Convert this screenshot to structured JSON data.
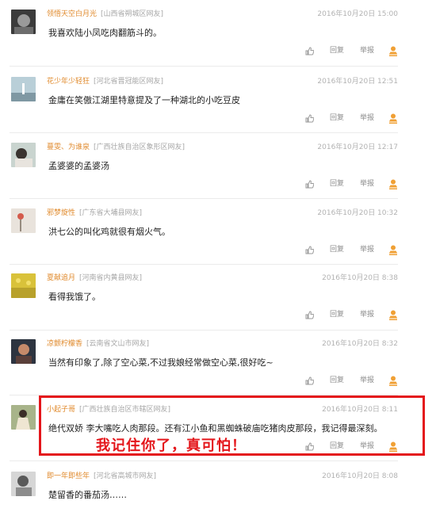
{
  "actions": {
    "reply": "回复",
    "report": "举报"
  },
  "comments": [
    {
      "user": "领悟天空白月光",
      "location": "[山西省朔城区网友]",
      "time": "2016年10月20日 15:00",
      "text": "我喜欢陆小凤吃肉翻筋斗的。"
    },
    {
      "user": "花少年少轻狂",
      "location": "[河北省晋冠能区网友]",
      "time": "2016年10月20日 12:51",
      "text": "金庸在笑傲江湖里特意提及了一种湖北的小吃豆皮"
    },
    {
      "user": "蔓雯、为谁泉",
      "location": "[广西壮族自治区象形区网友]",
      "time": "2016年10月20日 12:17",
      "text": "孟婆婆的孟婆汤"
    },
    {
      "user": "邪梦旋性",
      "location": "[广东省大埔县网友]",
      "time": "2016年10月20日 10:32",
      "text": "洪七公的叫化鸡就很有烟火气。"
    },
    {
      "user": "夏献追月",
      "location": "[河南省内黄县网友]",
      "time": "2016年10月20日 8:38",
      "text": "看得我饿了。"
    },
    {
      "user": "凉颤柠檬香",
      "location": "[云南省文山市网友]",
      "time": "2016年10月20日 8:32",
      "text": "当然有印象了,除了空心菜,不过我娘经常做空心菜,很好吃~"
    },
    {
      "user": "小起子哥",
      "location": "[广西壮族自治区市辖区网友]",
      "time": "2016年10月20日 8:11",
      "text": "绝代双娇 李大嘴吃人肉那段。还有江小鱼和黑蜘蛛破庙吃猪肉皮那段，我记得最深刻。"
    },
    {
      "user": "即一年即些年",
      "location": "[河北省高城市网友]",
      "time": "2016年10月20日 8:08",
      "text": "楚留香的番茄汤……"
    }
  ],
  "highlight_caption": "我记住你了，真可怕！",
  "colors": {
    "username": "#e08a2c",
    "highlight": "#e4161b",
    "accent_icon": "#f0a035"
  }
}
